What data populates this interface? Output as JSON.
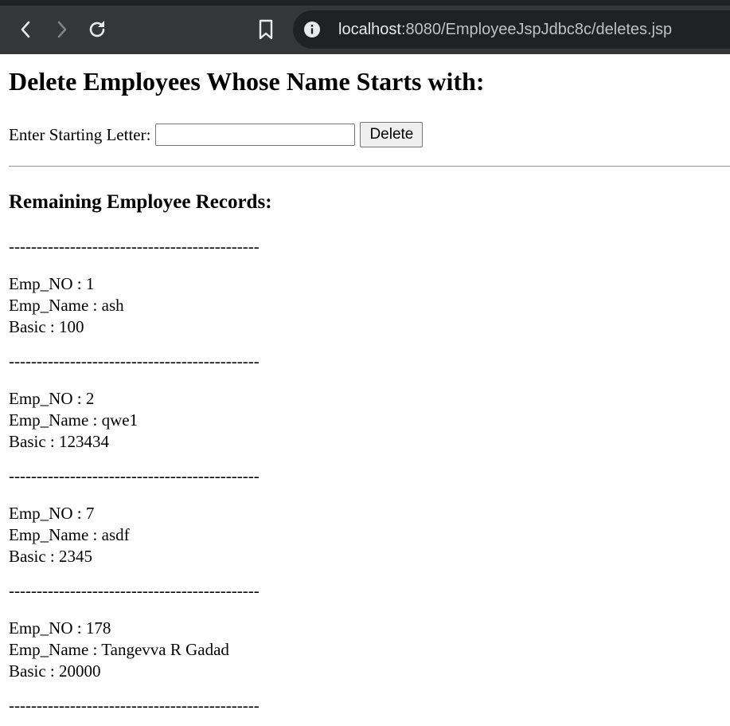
{
  "browser": {
    "url_host": "localhost",
    "url_rest": ":8080/EmployeeJspJdbc8c/deletes.jsp",
    "back_icon": "chevron-left-icon",
    "forward_icon": "chevron-right-icon",
    "reload_icon": "reload-icon",
    "bookmark_icon": "bookmark-icon",
    "info_icon": "info-icon"
  },
  "page": {
    "heading": "Delete Employees Whose Name Starts with:",
    "form": {
      "label": "Enter Starting Letter:",
      "input_value": "",
      "button_label": "Delete"
    },
    "subheading": "Remaining Employee Records:",
    "separator": "---------------------------------------------",
    "records": [
      {
        "emp_no": "Emp_NO : 1",
        "emp_name": "Emp_Name : ash",
        "basic": "Basic : 100"
      },
      {
        "emp_no": "Emp_NO : 2",
        "emp_name": "Emp_Name : qwe1",
        "basic": "Basic : 123434"
      },
      {
        "emp_no": "Emp_NO : 7",
        "emp_name": "Emp_Name : asdf",
        "basic": "Basic : 2345"
      },
      {
        "emp_no": "Emp_NO : 178",
        "emp_name": "Emp_Name : Tangevva R Gadad",
        "basic": "Basic : 20000"
      }
    ]
  }
}
